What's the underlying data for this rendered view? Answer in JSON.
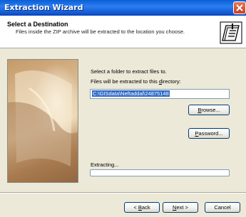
{
  "window": {
    "title": "Extraction Wizard"
  },
  "header": {
    "title": "Select a Destination",
    "subtitle": "Files inside the ZIP archive will be extracted to the location you choose."
  },
  "content": {
    "instruction": "Select a folder to extract files to.",
    "directory_label_pre": "Files will be extracted to this ",
    "directory_label_key": "d",
    "directory_label_post": "irectory:",
    "path_value": "C:\\GISdata\\Neftaddal\\24875148",
    "browse_pre": "",
    "browse_key": "B",
    "browse_post": "rowse...",
    "password_pre": "",
    "password_key": "P",
    "password_post": "assword...",
    "extracting_label": "Extracting...",
    "progress": 0
  },
  "footer": {
    "back_pre": "< ",
    "back_key": "B",
    "back_post": "ack",
    "next_pre": "",
    "next_key": "N",
    "next_post": "ext >",
    "cancel_label": "Cancel"
  },
  "colors": {
    "titlebar": "#0a5fd6",
    "window_bg": "#ece9d8",
    "selection": "#316ac5",
    "close_button": "#c6401f"
  },
  "icons": [
    "close-icon",
    "zip-folder-icon"
  ]
}
